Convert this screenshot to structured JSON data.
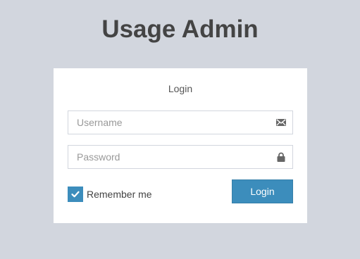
{
  "app": {
    "title": "Usage Admin"
  },
  "login_box": {
    "title": "Login",
    "username": {
      "placeholder": "Username",
      "value": "",
      "icon": "envelope-icon"
    },
    "password": {
      "placeholder": "Password",
      "value": "",
      "icon": "lock-icon"
    },
    "remember": {
      "label": "Remember me",
      "checked": true
    },
    "submit_label": "Login"
  },
  "colors": {
    "page_background": "#d2d6de",
    "box_background": "#ffffff",
    "accent": "#3c8dbc",
    "title_text": "#444444",
    "icon": "#666666"
  }
}
